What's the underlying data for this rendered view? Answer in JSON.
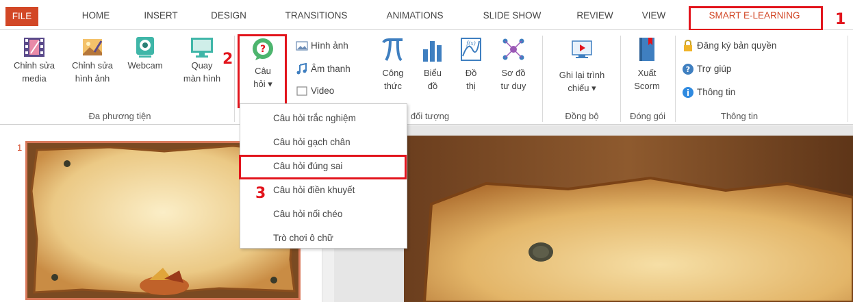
{
  "tabs": [
    "FILE",
    "HOME",
    "INSERT",
    "DESIGN",
    "TRANSITIONS",
    "ANIMATIONS",
    "SLIDE SHOW",
    "REVIEW",
    "VIEW",
    "SMART E-LEARNING"
  ],
  "steps": [
    "1",
    "2",
    "3"
  ],
  "ribbon": {
    "media": {
      "edit_media": [
        "Chỉnh sửa",
        "media"
      ],
      "edit_image": [
        "Chỉnh sửa",
        "hình ảnh"
      ],
      "webcam": "Webcam",
      "record_screen": [
        "Quay",
        "màn hình"
      ],
      "group_label": "Đa phương tiện"
    },
    "question": [
      "Câu",
      "hỏi ▾"
    ],
    "objects": {
      "image": "Hình ảnh",
      "sound": "Âm thanh",
      "video": "Video",
      "formula": [
        "Công",
        "thức"
      ],
      "chart": [
        "Biểu",
        "đồ"
      ],
      "graph": [
        "Đồ",
        "thị"
      ],
      "mindmap": [
        "Sơ đồ",
        "tư duy"
      ],
      "group_label": "đối tượng"
    },
    "sync": {
      "record": [
        "Ghi lại trình",
        "chiếu ▾"
      ],
      "group_label": "Đồng bộ"
    },
    "package": {
      "export": [
        "Xuất",
        "Scorm"
      ],
      "group_label": "Đóng gói"
    },
    "info": {
      "license": "Đăng ký bản quyền",
      "help": "Trợ giúp",
      "about": "Thông tin",
      "group_label": "Thông tin"
    }
  },
  "dropdown": [
    "Câu hỏi trắc nghiệm",
    "Câu hỏi gạch chân",
    "Câu hỏi đúng sai",
    "Câu hỏi điền khuyết",
    "Câu hỏi nối chéo",
    "Trò chơi ô chữ"
  ],
  "slide_number": "1",
  "colors": {
    "accent": "#d24726",
    "highlight": "#e2141c"
  }
}
